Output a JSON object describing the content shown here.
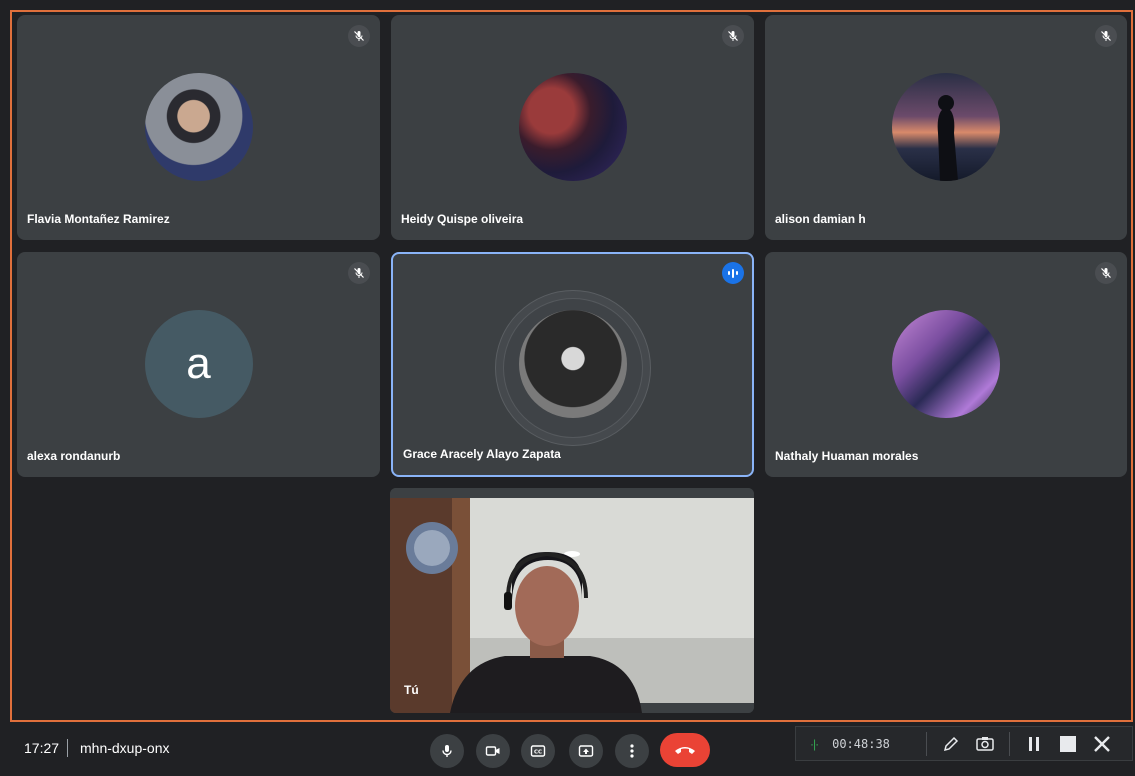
{
  "participants": [
    {
      "name": "Flavia Montañez Ramirez",
      "muted": true
    },
    {
      "name": "Heidy Quispe oliveira",
      "muted": true
    },
    {
      "name": "alison damian h",
      "muted": true
    },
    {
      "name": "alexa rondanurb",
      "muted": true,
      "initial": "a"
    },
    {
      "name": "Grace Aracely Alayo Zapata",
      "speaking": true
    },
    {
      "name": "Nathaly Huaman morales",
      "muted": true
    }
  ],
  "self": {
    "label": "Tú"
  },
  "footer": {
    "time": "17:27",
    "meeting_code": "mhn-dxup-onx"
  },
  "controls": [
    "mic-icon",
    "camera-icon",
    "captions-icon",
    "present-icon",
    "more-icon",
    "hangup-icon"
  ],
  "recorder": {
    "elapsed": "00:48:38"
  },
  "colors": {
    "accent": "#8ab4f8",
    "hangup": "#ea4335",
    "frame": "#e0703c",
    "tile": "#3c4043"
  }
}
